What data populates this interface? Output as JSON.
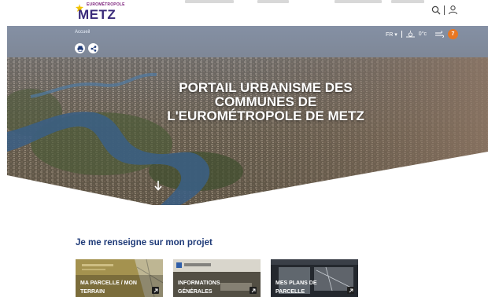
{
  "header": {
    "logo_small": "EUROMÉTROPOLE",
    "logo_main": "METZ",
    "search_icon": "search-icon",
    "account_icon": "account-icon"
  },
  "hero": {
    "breadcrumb": "Accueil",
    "language": "FR",
    "temperature": "0°c",
    "notification_count": "7",
    "title_lines": [
      "PORTAIL URBANISME DES",
      "COMMUNES DE",
      "L'EUROMÉTROPOLE DE METZ"
    ]
  },
  "section": {
    "title": "Je me renseigne sur mon projet",
    "cards": [
      {
        "label": "MA PARCELLE / MON TERRAIN",
        "tone": "#9a8a4a"
      },
      {
        "label": "INFORMATIONS GÉNÉRALES",
        "tone": "#6f6a5c"
      },
      {
        "label": "MES PLANS DE PARCELLE",
        "tone": "#2b2f36"
      }
    ]
  },
  "colors": {
    "brand_blue": "#1e3a78",
    "badge_orange": "#e87722"
  }
}
